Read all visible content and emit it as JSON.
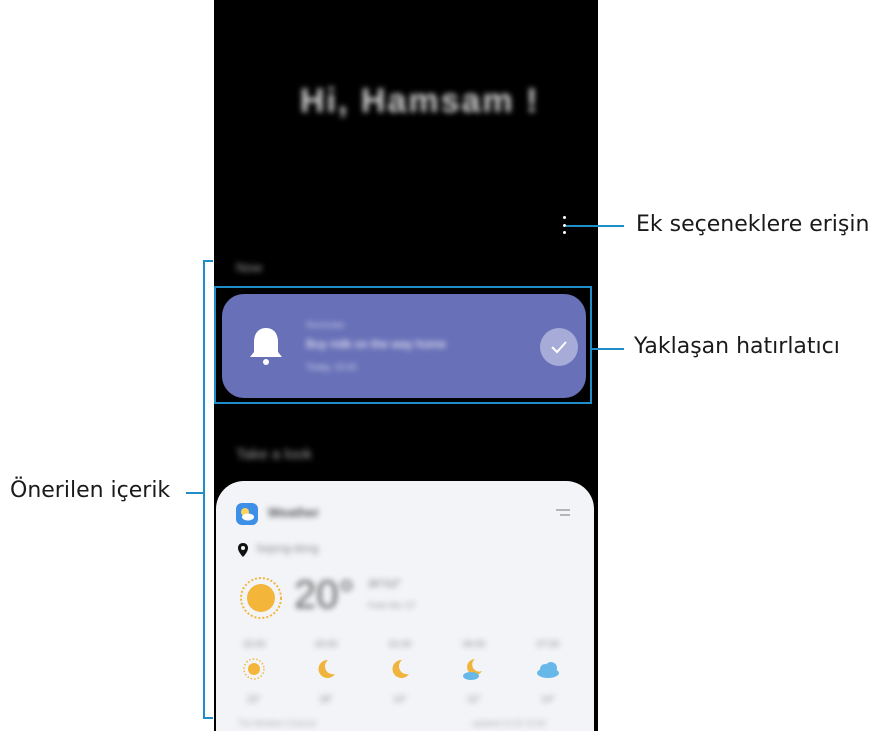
{
  "screen": {
    "greeting": "Hi, Hamsam !",
    "sections": {
      "now": "Now",
      "take_a_look": "Take a look"
    },
    "reminder": {
      "category": "Reminder",
      "title": "Buy milk on the way home",
      "time": "Today, 15:00"
    },
    "weather": {
      "title": "Weather",
      "location": "Sejong-dong",
      "temperature": "20°",
      "temperature_detail": "20°/12°",
      "updated": "Feels like 13°",
      "forecast": [
        {
          "time": "15:00",
          "icon": "sun-icon",
          "temp": "22°"
        },
        {
          "time": "20:00",
          "icon": "moon-icon",
          "temp": "18°"
        },
        {
          "time": "01:00",
          "icon": "moon-icon",
          "temp": "14°"
        },
        {
          "time": "06:00",
          "icon": "moon-cloud-icon",
          "temp": "12°"
        },
        {
          "time": "07:00",
          "icon": "cloud-icon",
          "temp": "14°"
        }
      ],
      "footer_left": "The Weather Channel",
      "footer_right": "updated 10.25 15:00"
    }
  },
  "callouts": {
    "more_options": "Ek seçeneklere erişin",
    "upcoming_reminder": "Yaklaşan hatırlatıcı",
    "suggested_content": "Önerilen içerik"
  },
  "colors": {
    "reminder_card": "#6870b8",
    "callout_line": "#1f8ec8",
    "sun": "#f3b63a",
    "moon": "#f0b43c",
    "cloud": "#67b8e8"
  }
}
